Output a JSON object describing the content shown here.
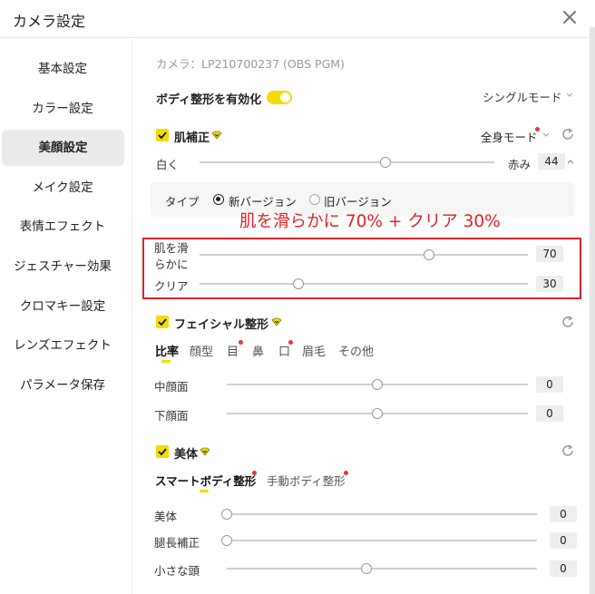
{
  "window": {
    "title": "カメラ設定"
  },
  "sidebar": {
    "items": [
      {
        "label": "基本設定",
        "active": false
      },
      {
        "label": "カラー設定",
        "active": false
      },
      {
        "label": "美顔設定",
        "active": true
      },
      {
        "label": "メイク設定",
        "active": false
      },
      {
        "label": "表情エフェクト",
        "active": false
      },
      {
        "label": "ジェスチャー効果",
        "active": false
      },
      {
        "label": "クロマキー設定",
        "active": false
      },
      {
        "label": "レンズエフェクト",
        "active": false
      },
      {
        "label": "パラメータ保存",
        "active": false
      }
    ]
  },
  "main": {
    "camera_label": "カメラ：LP210700237 (OBS PGM)",
    "body_shaping_toggle": {
      "label": "ボディ整形を有効化",
      "on": true
    },
    "mode_select": "シングルモード",
    "skin": {
      "title": "肌補正",
      "mode": "全身モード",
      "tone": {
        "left_label": "白く",
        "right_label": "赤み",
        "value": "44",
        "fraction": 0.63
      },
      "type": {
        "label": "タイプ",
        "options": [
          {
            "label": "新バージョン",
            "selected": true
          },
          {
            "label": "旧バージョン",
            "selected": false
          }
        ]
      },
      "smooth": {
        "label_line1": "肌を滑",
        "label_line2": "らかに",
        "value": "70",
        "fraction": 0.7
      },
      "clear": {
        "label": "クリア",
        "value": "30",
        "fraction": 0.3
      }
    },
    "annotation": "肌を滑らかに 70% + クリア 30%",
    "facial": {
      "title": "フェイシャル整形",
      "tabs": [
        {
          "label": "比率",
          "active": true,
          "dot": false
        },
        {
          "label": "顔型",
          "active": false,
          "dot": false
        },
        {
          "label": "目",
          "active": false,
          "dot": true
        },
        {
          "label": "鼻",
          "active": false,
          "dot": false
        },
        {
          "label": "口",
          "active": false,
          "dot": true
        },
        {
          "label": "眉毛",
          "active": false,
          "dot": false
        },
        {
          "label": "その他",
          "active": false,
          "dot": false
        }
      ],
      "sliders": [
        {
          "label": "中顔面",
          "value": "0",
          "fraction": 0.5
        },
        {
          "label": "下顔面",
          "value": "0",
          "fraction": 0.5
        }
      ]
    },
    "body": {
      "title": "美体",
      "tabs": [
        {
          "label": "スマートボディ整形",
          "active": true,
          "dot": true
        },
        {
          "label": "手動ボディ整形",
          "active": false,
          "dot": true
        }
      ],
      "sliders": [
        {
          "label": "美体",
          "value": "0",
          "fraction": 0.0
        },
        {
          "label": "腿長補正",
          "value": "0",
          "fraction": 0.0
        },
        {
          "label": "小さな頭",
          "value": "0",
          "fraction": 0.45
        }
      ]
    }
  },
  "colors": {
    "accent": "#f4dc00",
    "highlight": "#d8262b",
    "notify_dot": "#e8333a"
  }
}
